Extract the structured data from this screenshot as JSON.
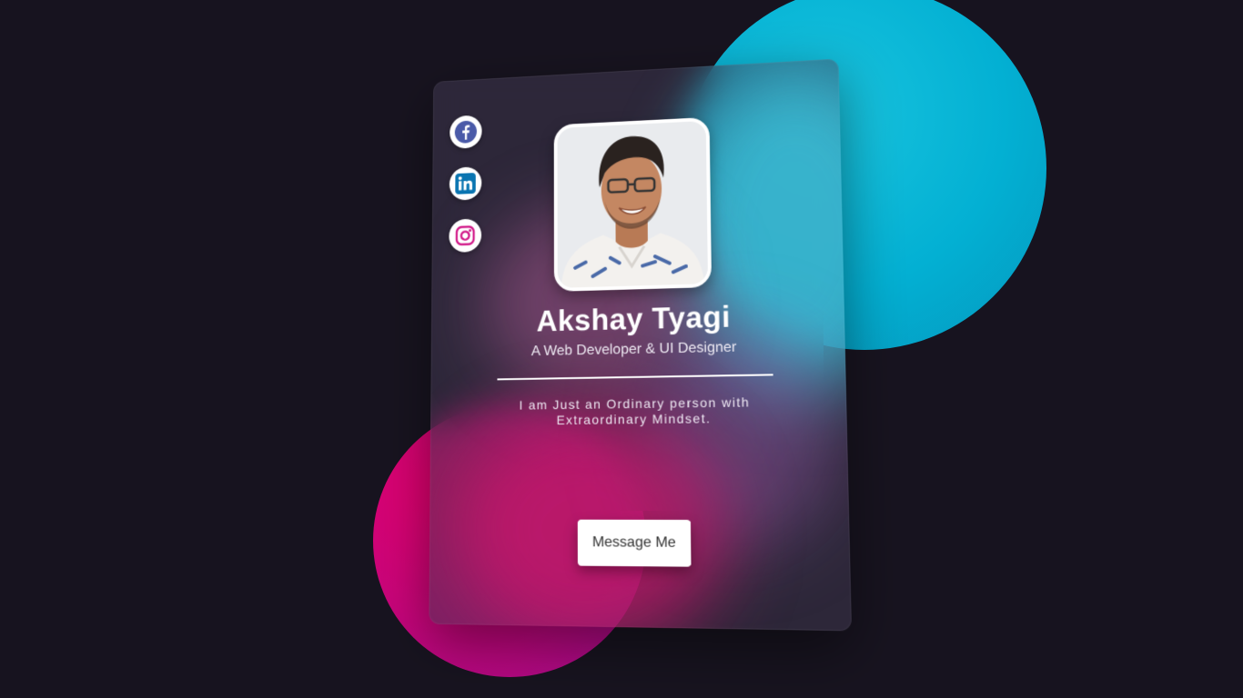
{
  "profile": {
    "name": "Akshay Tyagi",
    "role": "A Web Developer & UI Designer",
    "bio": "I am Just an Ordinary person with Extraordinary Mindset.",
    "message_button": "Message Me"
  },
  "social": [
    {
      "icon": "facebook-icon",
      "color": "#4a5aa8"
    },
    {
      "icon": "linkedin-icon",
      "color": "#0a75b1"
    },
    {
      "icon": "instagram-icon",
      "color": "#d21b8a"
    }
  ],
  "colors": {
    "background": "#17131f",
    "accent_cyan": "#03b0d3",
    "accent_pink": "#d5036f",
    "card": "#3e364e"
  }
}
